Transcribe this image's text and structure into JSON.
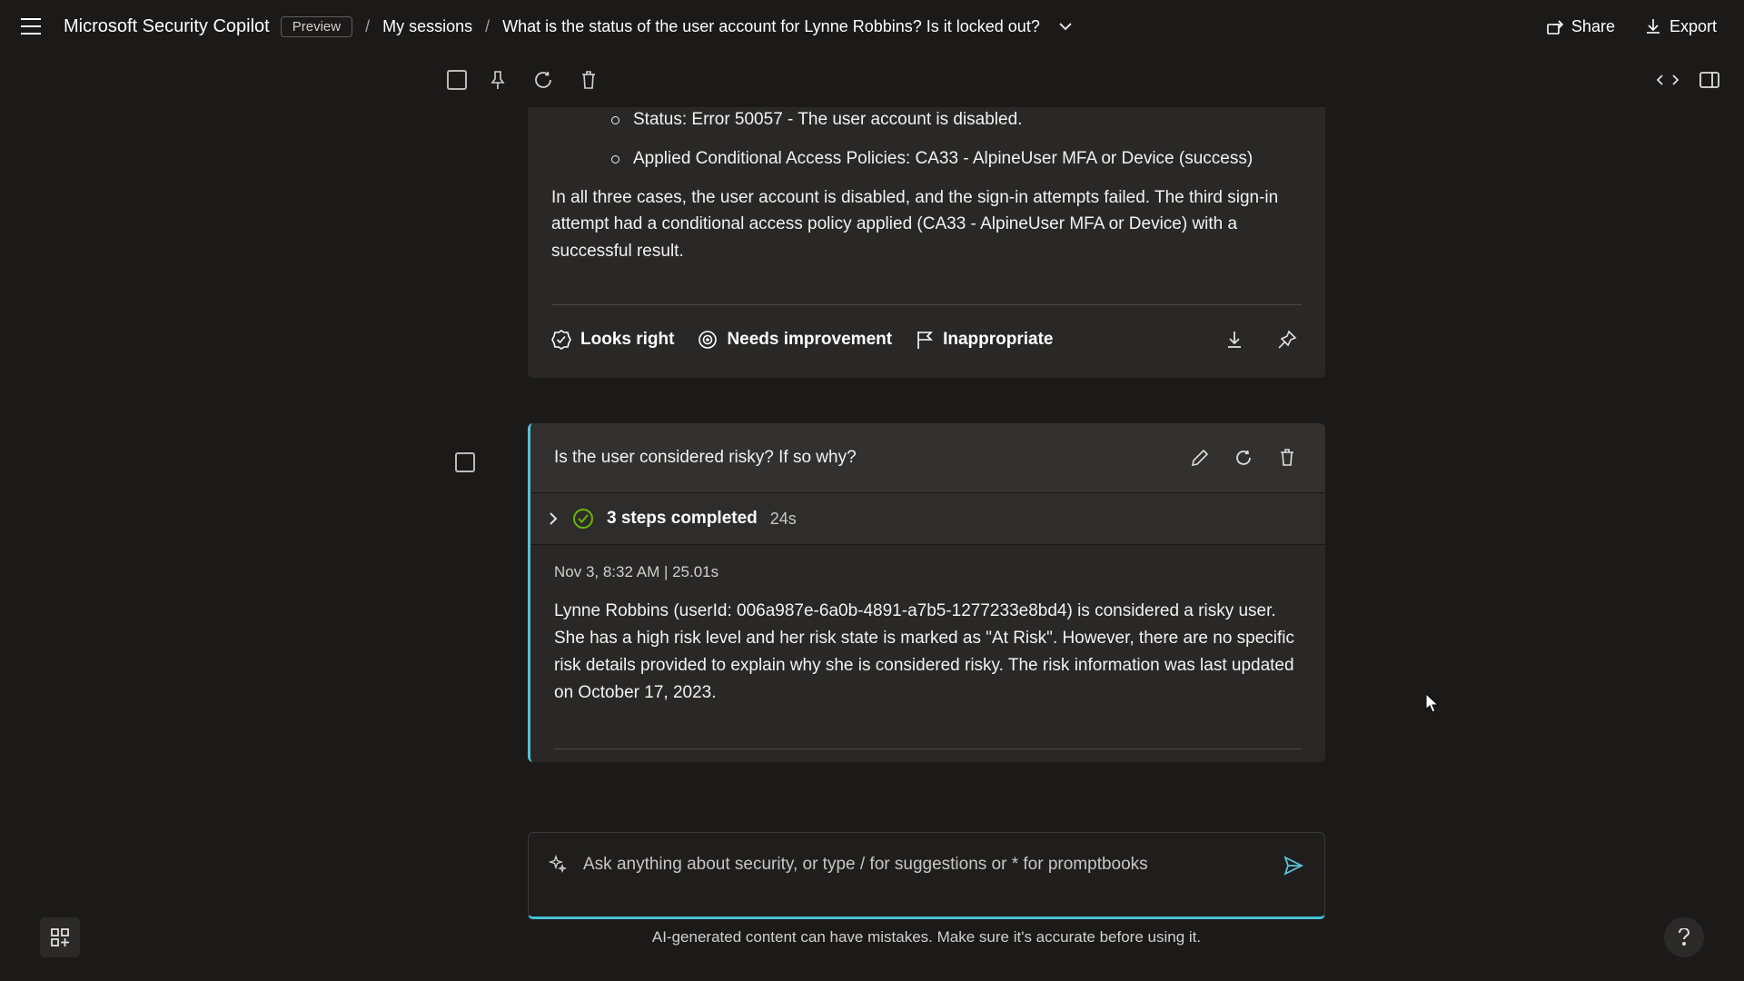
{
  "header": {
    "brand": "Microsoft Security Copilot",
    "badge": "Preview",
    "crumb_sessions": "My sessions",
    "crumb_title": "What is the status of the user account for Lynne Robbins? Is it locked out?",
    "share": "Share",
    "export": "Export"
  },
  "card1": {
    "bullet1": "Status: Error 50057 - The user account is disabled.",
    "bullet2": "Applied Conditional Access Policies: CA33 - AlpineUser MFA or Device (success)",
    "para": "In all three cases, the user account is disabled, and the sign-in attempts failed. The third sign-in attempt had a conditional access policy applied (CA33 - AlpineUser MFA or Device) with a successful result."
  },
  "feedback": {
    "looks_right": "Looks right",
    "needs_improvement": "Needs improvement",
    "inappropriate": "Inappropriate"
  },
  "turn": {
    "prompt": "Is the user considered risky? If so why?",
    "steps_label": "3 steps completed",
    "steps_time": "24s",
    "timestamp": "Nov 3, 8:32 AM  |  25.01s",
    "answer": "Lynne Robbins (userId: 006a987e-6a0b-4891-a7b5-1277233e8bd4) is considered a risky user. She has a high risk level and her risk state is marked as \"At Risk\". However, there are no specific risk details provided to explain why she is considered risky. The risk information was last updated on October 17, 2023."
  },
  "input": {
    "placeholder": "Ask anything about security, or type / for suggestions or * for promptbooks"
  },
  "disclaimer": "AI-generated content can have mistakes. Make sure it's accurate before using it."
}
